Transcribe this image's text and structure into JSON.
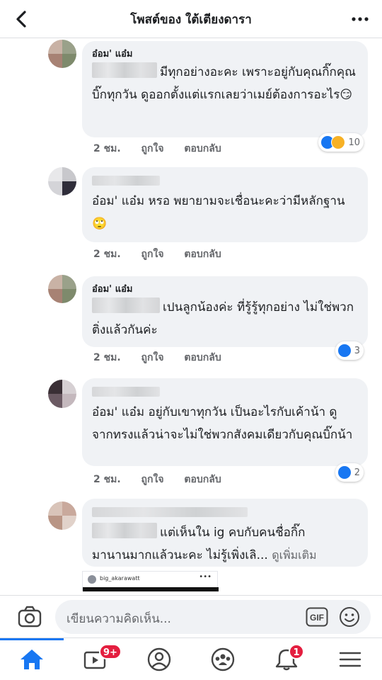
{
  "header": {
    "title": "โพสต์ของ ใต้เตียงดารา"
  },
  "comments": [
    {
      "author": "อ๋อม' แอ๋ม",
      "text": "มีทุกอย่างอะคะ เพราะอยู่กับคุณกิ๊กคุณบิ๊กทุกวัน ดูออกตั้งแต่แรกเลยว่าเมย์ต้องการอะไร😏",
      "time": "2 ชม.",
      "like_label": "ถูกใจ",
      "reply_label": "ตอบกลับ",
      "reaction_count": "10"
    },
    {
      "author": "",
      "text": "อ๋อม' แอ๋ม หรอ พยายามจะเชื่อนะคะว่ามีหลักฐาน 🙄",
      "time": "2 ชม.",
      "like_label": "ถูกใจ",
      "reply_label": "ตอบกลับ",
      "reaction_count": ""
    },
    {
      "author": "อ๋อม' แอ๋ม",
      "text": "เปนลูกน้องค่ะ ที่รู้รู้ทุกอย่าง ไม่ใช่พวกติ่งแล้วกันค่ะ",
      "time": "2 ชม.",
      "like_label": "ถูกใจ",
      "reply_label": "ตอบกลับ",
      "reaction_count": "3"
    },
    {
      "author": "",
      "text": "อ๋อม' แอ๋ม อยู่กับเขาทุกวัน เป็นอะไรกับเค้าน้า ดูจากทรงแล้วน่าจะไม่ใช่พวกสังคมเดียวกับคุณบิ๊กน้า",
      "time": "2 ชม.",
      "like_label": "ถูกใจ",
      "reply_label": "ตอบกลับ",
      "reaction_count": "2"
    },
    {
      "author": "",
      "text_line1": "แต่เห็นใน ig คบกับคนชื่อกิ๊ก",
      "text_line2": "มานานมากแล้วนะคะ ไม่รู้เพิ่งเลิ...",
      "see_more": "ดูเพิ่มเติม"
    }
  ],
  "embed": {
    "handle": "big_akarawatt",
    "dots": "•••"
  },
  "composer": {
    "placeholder": "เขียนความคิดเห็น...",
    "gif_label": "GIF"
  },
  "tabbar": {
    "video_badge": "9+",
    "notifications_badge": "1",
    "accent": "#1877f2"
  }
}
